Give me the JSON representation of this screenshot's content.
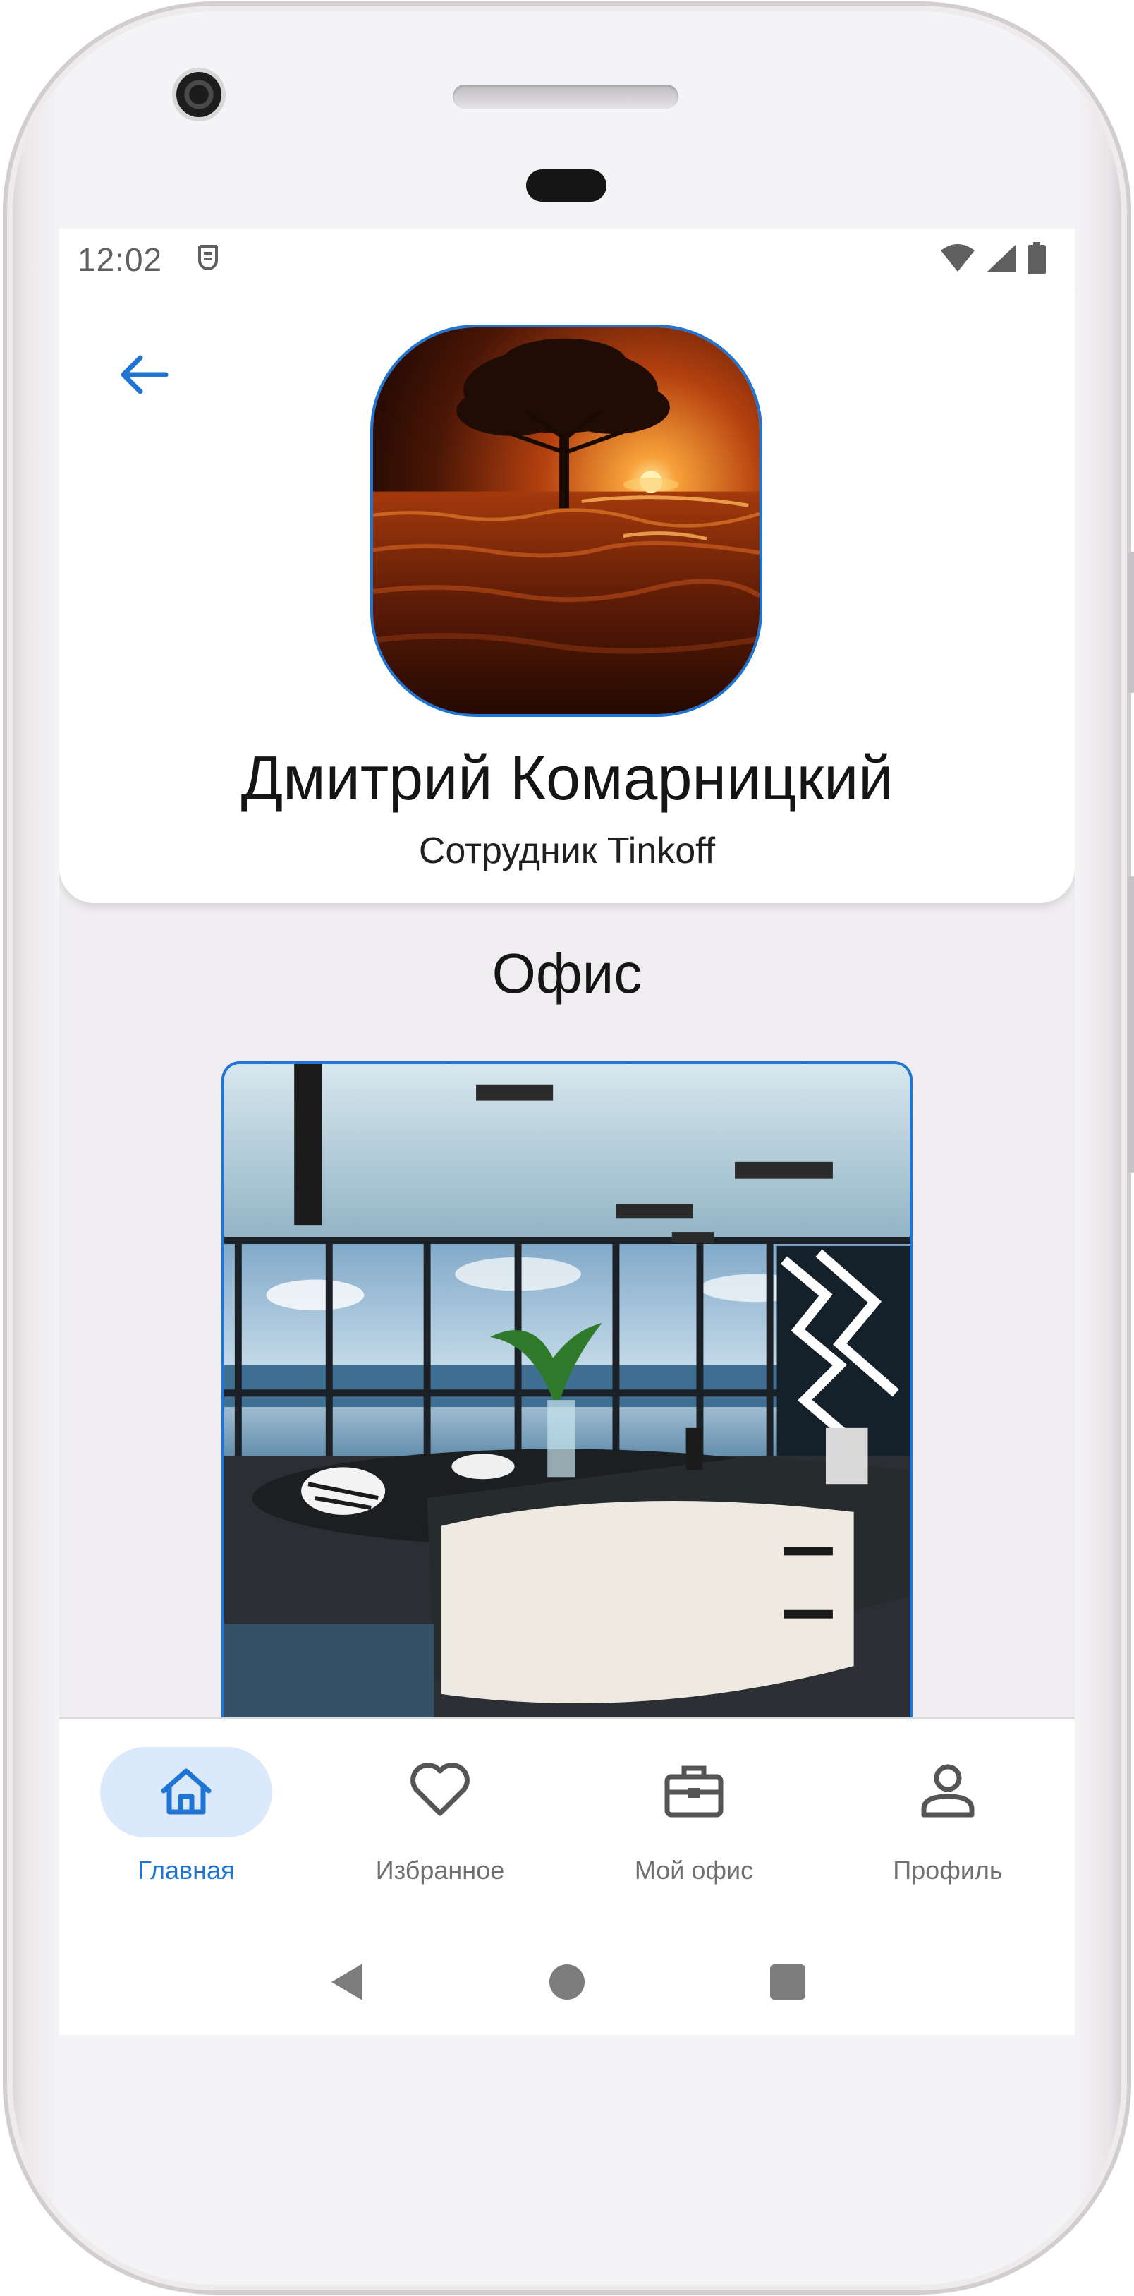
{
  "status_bar": {
    "time": "12:02",
    "app_icon": "app-notification-icon",
    "icons": [
      "wifi-icon",
      "cellular-signal-icon",
      "battery-icon"
    ]
  },
  "header": {
    "back_icon": "arrow-left-icon",
    "avatar_image": "sunset-tree-over-water"
  },
  "profile": {
    "name": "Дмитрий Комарницкий",
    "role": "Сотрудник Tinkoff"
  },
  "office": {
    "title": "Офис",
    "image": "modern-office-interior-with-sea-view"
  },
  "bottom_nav": {
    "items": [
      {
        "label": "Главная",
        "icon": "home-icon",
        "active": true
      },
      {
        "label": "Избранное",
        "icon": "heart-icon",
        "active": false
      },
      {
        "label": "Мой офис",
        "icon": "briefcase-icon",
        "active": false
      },
      {
        "label": "Профиль",
        "icon": "person-icon",
        "active": false
      }
    ]
  },
  "system_nav": [
    "back-triangle-icon",
    "home-circle-icon",
    "recents-square-icon"
  ],
  "colors": {
    "accent": "#1f74d4",
    "active_pill": "#dbeafb",
    "screen_background": "#efedef",
    "inactive_text": "#6f6f6f"
  }
}
